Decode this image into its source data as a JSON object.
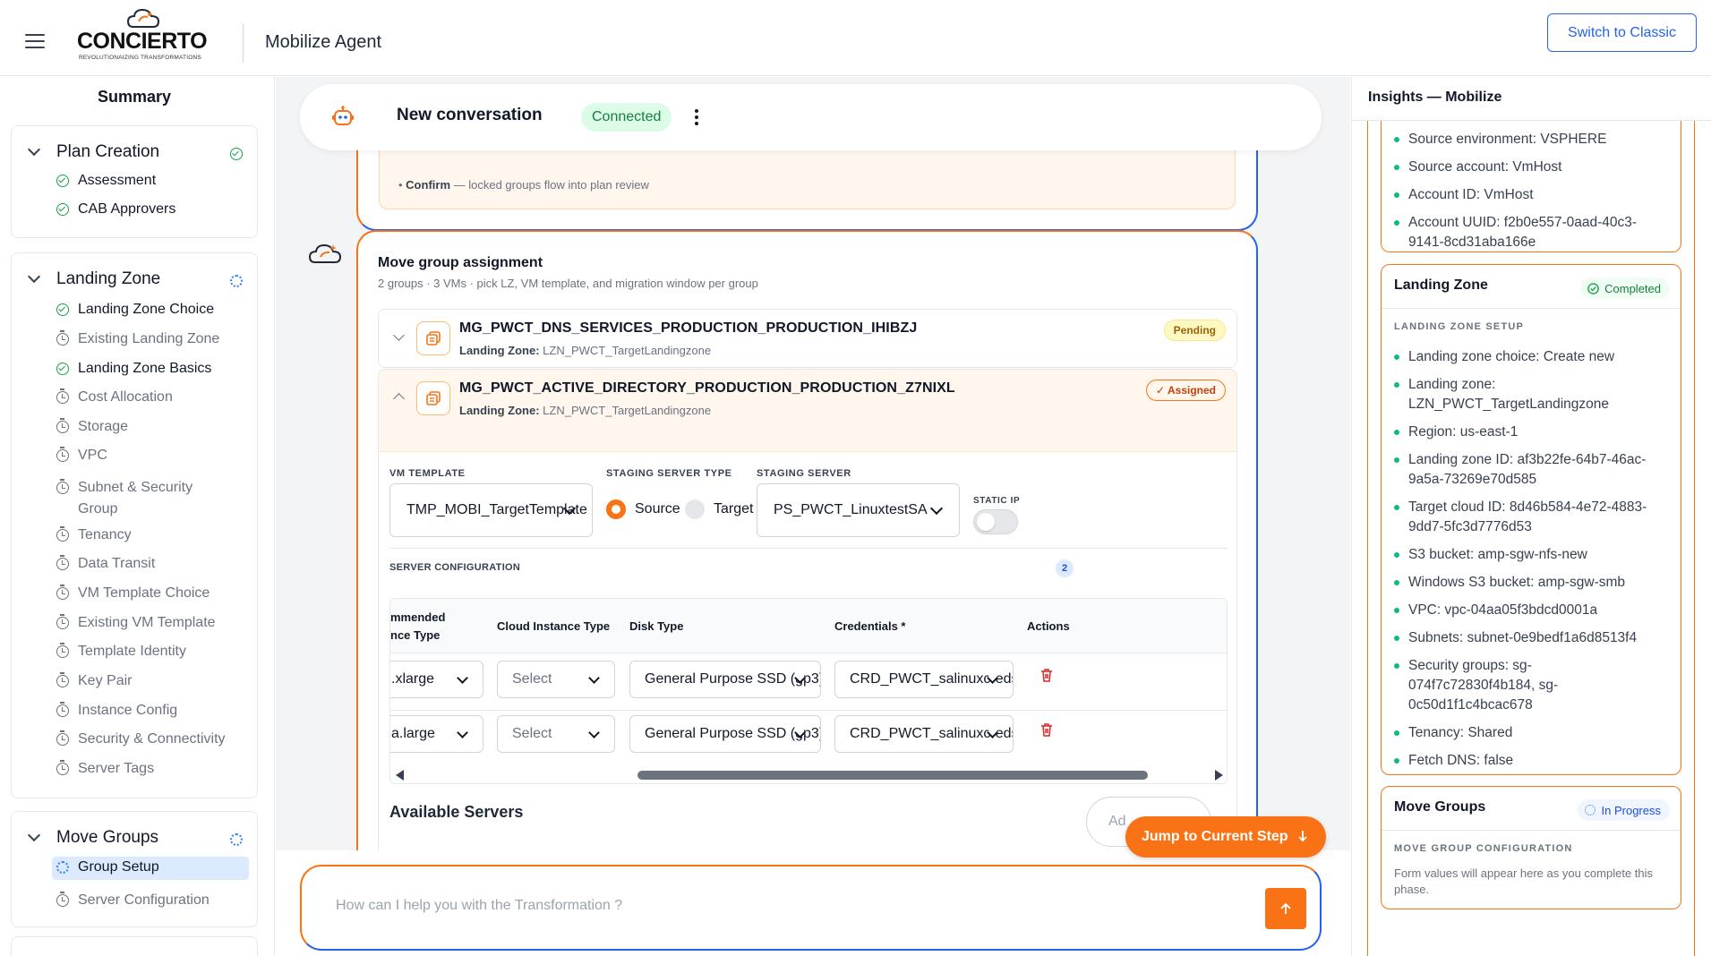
{
  "header": {
    "logo_text": "CONCIERTO",
    "logo_tagline": "REVOLUTIONAIZING TRANSFORMATIONS",
    "app_title": "Mobilize Agent",
    "switch_label": "Switch to Classic"
  },
  "sidebar": {
    "title": "Summary",
    "phases": [
      {
        "name": "Plan Creation",
        "status": "complete",
        "steps": [
          {
            "label": "Assessment",
            "status": "complete"
          },
          {
            "label": "CAB Approvers",
            "status": "complete"
          }
        ]
      },
      {
        "name": "Landing Zone",
        "status": "in-progress",
        "steps": [
          {
            "label": "Landing Zone Choice",
            "status": "complete"
          },
          {
            "label": "Existing Landing Zone",
            "status": "pending"
          },
          {
            "label": "Landing Zone Basics",
            "status": "complete"
          },
          {
            "label": "Cost Allocation",
            "status": "pending"
          },
          {
            "label": "Storage",
            "status": "pending"
          },
          {
            "label": "VPC",
            "status": "pending"
          },
          {
            "label": "Subnet & Security Group",
            "status": "pending"
          },
          {
            "label": "Tenancy",
            "status": "pending"
          },
          {
            "label": "Data Transit",
            "status": "pending"
          },
          {
            "label": "VM Template Choice",
            "status": "pending"
          },
          {
            "label": "Existing VM Template",
            "status": "pending"
          },
          {
            "label": "Template Identity",
            "status": "pending"
          },
          {
            "label": "Key Pair",
            "status": "pending"
          },
          {
            "label": "Instance Config",
            "status": "pending"
          },
          {
            "label": "Security & Connectivity",
            "status": "pending"
          },
          {
            "label": "Server Tags",
            "status": "pending"
          }
        ]
      },
      {
        "name": "Move Groups",
        "status": "in-progress",
        "steps": [
          {
            "label": "Group Setup",
            "status": "active"
          },
          {
            "label": "Server Configuration",
            "status": "pending"
          }
        ]
      }
    ]
  },
  "conversation": {
    "title": "New conversation",
    "status": "Connected"
  },
  "previous_card": {
    "confirm_label": "Confirm",
    "confirm_text": " — locked groups flow into plan review"
  },
  "assignment": {
    "title": "Move group assignment",
    "subtitle": "2 groups · 3 VMs · pick LZ, VM template, and migration window per group",
    "lz_label": "Landing Zone:",
    "groups": [
      {
        "name": "MG_PWCT_DNS_SERVICES_PRODUCTION_PRODUCTION_IHIBZJ",
        "landing_zone": "LZN_PWCT_TargetLandingzone",
        "status": "Pending"
      },
      {
        "name": "MG_PWCT_ACTIVE_DIRECTORY_PRODUCTION_PRODUCTION_Z7NIXL",
        "landing_zone": "LZN_PWCT_TargetLandingzone",
        "status": "✓ Assigned"
      }
    ],
    "form": {
      "vm_template_label": "VM TEMPLATE",
      "vm_template_value": "TMP_MOBI_TargetTemplate",
      "staging_type_label": "STAGING SERVER TYPE",
      "staging_type_options": [
        "Source",
        "Target"
      ],
      "staging_type_selected": "Source",
      "staging_server_label": "STAGING SERVER",
      "staging_server_value": "PS_PWCT_LinuxtestSA",
      "static_ip_label": "STATIC IP",
      "static_ip_on": false
    },
    "server_config": {
      "label": "SERVER CONFIGURATION",
      "count": "2",
      "columns": [
        "mmended\nnce Type",
        "Cloud Instance Type",
        "Disk Type",
        "Credentials *",
        "Actions"
      ],
      "rows": [
        {
          "recommended": ".xlarge",
          "cloud_type": "Select",
          "disk": "General Purpose SSD (gp3)",
          "credentials": "CRD_PWCT_salinuxcreds"
        },
        {
          "recommended": "a.large",
          "cloud_type": "Select",
          "disk": "General Purpose SSD (gp3)",
          "credentials": "CRD_PWCT_salinuxcreds"
        }
      ]
    },
    "available_title": "Available Servers",
    "add_label": "Ad"
  },
  "jump_label": "Jump to Current Step",
  "chat_input": {
    "placeholder": "How can I help you with the Transformation ?"
  },
  "insights": {
    "title": "Insights — Mobilize",
    "top_items": [
      "Source environment: VSPHERE",
      "Source account: VmHost",
      "Account ID: VmHost",
      "Account UUID: f2b0e557-0aad-40c3-9141-8cd31aba166e"
    ],
    "landing_zone": {
      "name": "Landing Zone",
      "status": "Completed",
      "section": "LANDING ZONE SETUP",
      "items": [
        "Landing zone choice: Create new",
        "Landing zone: LZN_PWCT_TargetLandingzone",
        "Region: us-east-1",
        "Landing zone ID: af3b22fe-64b7-46ac-9a5a-73269e70d585",
        "Target cloud ID: 8d46b584-4e72-4883-9dd7-5fc3d7776d53",
        "S3 bucket: amp-sgw-nfs-new",
        "Windows S3 bucket: amp-sgw-smb",
        "VPC: vpc-04aa05f3bdcd0001a",
        "Subnets: subnet-0e9bedf1a6d8513f4",
        "Security groups: sg-074f7c72830f4b184, sg-0c50d1f1c4bcac678",
        "Tenancy: Shared",
        "Fetch DNS: false"
      ]
    },
    "move_groups": {
      "name": "Move Groups",
      "status": "In Progress",
      "section": "MOVE GROUP CONFIGURATION",
      "note": "Form values will appear here as you complete this phase."
    }
  },
  "colors": {
    "accent": "#f97316",
    "primary": "#2563eb",
    "success": "#16a34a"
  }
}
